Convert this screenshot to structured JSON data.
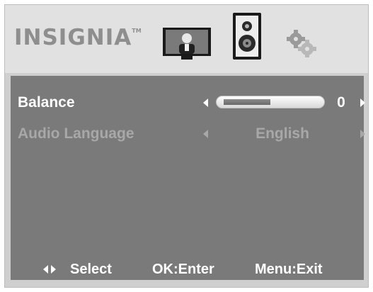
{
  "header": {
    "logo_text": "INSIGNIA",
    "logo_trademark": "TM",
    "tabs": [
      {
        "name": "picture",
        "icon": "tv-icon"
      },
      {
        "name": "audio",
        "icon": "speaker-icon",
        "selected": true
      },
      {
        "name": "setup",
        "icon": "gears-icon"
      }
    ]
  },
  "menu": {
    "items": [
      {
        "label": "Balance",
        "value": "0",
        "slider_level": 0.5,
        "active": true
      },
      {
        "label": "Audio Language",
        "value": "English",
        "active": false
      }
    ]
  },
  "footer": {
    "select_label": "Select",
    "enter_label": "OK:Enter",
    "exit_label": "Menu:Exit"
  },
  "colors": {
    "panel": "#7a7a7a",
    "header": "#e1e1e1",
    "active_text": "#ffffff",
    "inactive_text": "#a8a8a8"
  }
}
